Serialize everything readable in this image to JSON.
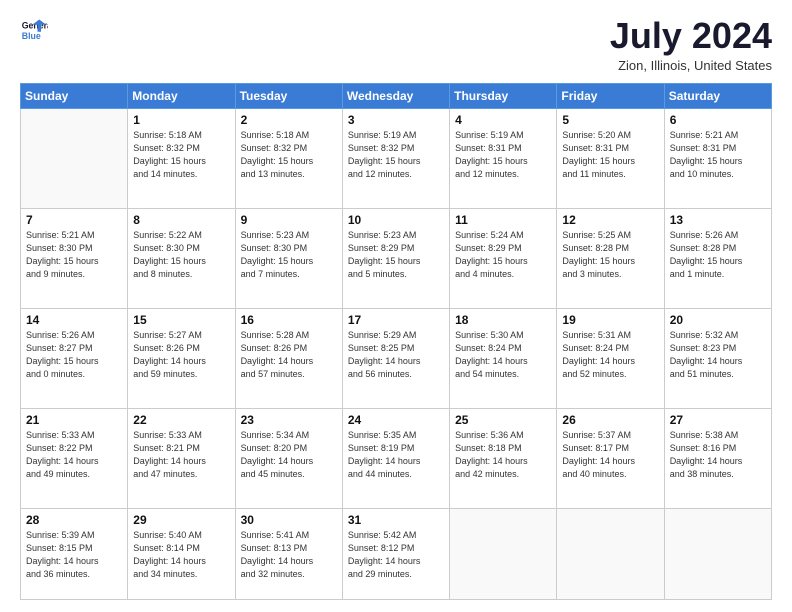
{
  "header": {
    "logo_line1": "General",
    "logo_line2": "Blue",
    "month": "July 2024",
    "location": "Zion, Illinois, United States"
  },
  "weekdays": [
    "Sunday",
    "Monday",
    "Tuesday",
    "Wednesday",
    "Thursday",
    "Friday",
    "Saturday"
  ],
  "weeks": [
    [
      {
        "day": "",
        "info": ""
      },
      {
        "day": "1",
        "info": "Sunrise: 5:18 AM\nSunset: 8:32 PM\nDaylight: 15 hours\nand 14 minutes."
      },
      {
        "day": "2",
        "info": "Sunrise: 5:18 AM\nSunset: 8:32 PM\nDaylight: 15 hours\nand 13 minutes."
      },
      {
        "day": "3",
        "info": "Sunrise: 5:19 AM\nSunset: 8:32 PM\nDaylight: 15 hours\nand 12 minutes."
      },
      {
        "day": "4",
        "info": "Sunrise: 5:19 AM\nSunset: 8:31 PM\nDaylight: 15 hours\nand 12 minutes."
      },
      {
        "day": "5",
        "info": "Sunrise: 5:20 AM\nSunset: 8:31 PM\nDaylight: 15 hours\nand 11 minutes."
      },
      {
        "day": "6",
        "info": "Sunrise: 5:21 AM\nSunset: 8:31 PM\nDaylight: 15 hours\nand 10 minutes."
      }
    ],
    [
      {
        "day": "7",
        "info": "Sunrise: 5:21 AM\nSunset: 8:30 PM\nDaylight: 15 hours\nand 9 minutes."
      },
      {
        "day": "8",
        "info": "Sunrise: 5:22 AM\nSunset: 8:30 PM\nDaylight: 15 hours\nand 8 minutes."
      },
      {
        "day": "9",
        "info": "Sunrise: 5:23 AM\nSunset: 8:30 PM\nDaylight: 15 hours\nand 7 minutes."
      },
      {
        "day": "10",
        "info": "Sunrise: 5:23 AM\nSunset: 8:29 PM\nDaylight: 15 hours\nand 5 minutes."
      },
      {
        "day": "11",
        "info": "Sunrise: 5:24 AM\nSunset: 8:29 PM\nDaylight: 15 hours\nand 4 minutes."
      },
      {
        "day": "12",
        "info": "Sunrise: 5:25 AM\nSunset: 8:28 PM\nDaylight: 15 hours\nand 3 minutes."
      },
      {
        "day": "13",
        "info": "Sunrise: 5:26 AM\nSunset: 8:28 PM\nDaylight: 15 hours\nand 1 minute."
      }
    ],
    [
      {
        "day": "14",
        "info": "Sunrise: 5:26 AM\nSunset: 8:27 PM\nDaylight: 15 hours\nand 0 minutes."
      },
      {
        "day": "15",
        "info": "Sunrise: 5:27 AM\nSunset: 8:26 PM\nDaylight: 14 hours\nand 59 minutes."
      },
      {
        "day": "16",
        "info": "Sunrise: 5:28 AM\nSunset: 8:26 PM\nDaylight: 14 hours\nand 57 minutes."
      },
      {
        "day": "17",
        "info": "Sunrise: 5:29 AM\nSunset: 8:25 PM\nDaylight: 14 hours\nand 56 minutes."
      },
      {
        "day": "18",
        "info": "Sunrise: 5:30 AM\nSunset: 8:24 PM\nDaylight: 14 hours\nand 54 minutes."
      },
      {
        "day": "19",
        "info": "Sunrise: 5:31 AM\nSunset: 8:24 PM\nDaylight: 14 hours\nand 52 minutes."
      },
      {
        "day": "20",
        "info": "Sunrise: 5:32 AM\nSunset: 8:23 PM\nDaylight: 14 hours\nand 51 minutes."
      }
    ],
    [
      {
        "day": "21",
        "info": "Sunrise: 5:33 AM\nSunset: 8:22 PM\nDaylight: 14 hours\nand 49 minutes."
      },
      {
        "day": "22",
        "info": "Sunrise: 5:33 AM\nSunset: 8:21 PM\nDaylight: 14 hours\nand 47 minutes."
      },
      {
        "day": "23",
        "info": "Sunrise: 5:34 AM\nSunset: 8:20 PM\nDaylight: 14 hours\nand 45 minutes."
      },
      {
        "day": "24",
        "info": "Sunrise: 5:35 AM\nSunset: 8:19 PM\nDaylight: 14 hours\nand 44 minutes."
      },
      {
        "day": "25",
        "info": "Sunrise: 5:36 AM\nSunset: 8:18 PM\nDaylight: 14 hours\nand 42 minutes."
      },
      {
        "day": "26",
        "info": "Sunrise: 5:37 AM\nSunset: 8:17 PM\nDaylight: 14 hours\nand 40 minutes."
      },
      {
        "day": "27",
        "info": "Sunrise: 5:38 AM\nSunset: 8:16 PM\nDaylight: 14 hours\nand 38 minutes."
      }
    ],
    [
      {
        "day": "28",
        "info": "Sunrise: 5:39 AM\nSunset: 8:15 PM\nDaylight: 14 hours\nand 36 minutes."
      },
      {
        "day": "29",
        "info": "Sunrise: 5:40 AM\nSunset: 8:14 PM\nDaylight: 14 hours\nand 34 minutes."
      },
      {
        "day": "30",
        "info": "Sunrise: 5:41 AM\nSunset: 8:13 PM\nDaylight: 14 hours\nand 32 minutes."
      },
      {
        "day": "31",
        "info": "Sunrise: 5:42 AM\nSunset: 8:12 PM\nDaylight: 14 hours\nand 29 minutes."
      },
      {
        "day": "",
        "info": ""
      },
      {
        "day": "",
        "info": ""
      },
      {
        "day": "",
        "info": ""
      }
    ]
  ]
}
